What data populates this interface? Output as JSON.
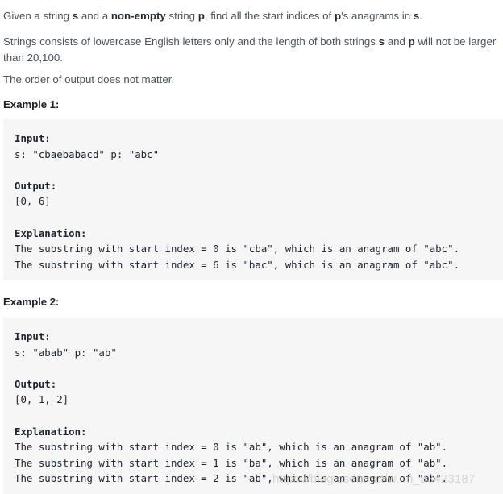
{
  "problem": {
    "paragraph1": {
      "seg1": "Given a string ",
      "bold1": "s",
      "seg2": " and a ",
      "bold2": "non-empty",
      "seg3": " string ",
      "bold3": "p",
      "seg4": ", find all the start indices of ",
      "bold4": "p",
      "seg5": "'s anagrams in ",
      "bold5": "s",
      "seg6": "."
    },
    "paragraph2": {
      "seg1": "Strings consists of lowercase English letters only and the length of both strings ",
      "bold1": "s",
      "seg2": " and ",
      "bold2": "p",
      "seg3": " will not be larger than 20,100."
    },
    "paragraph3": "The order of output does not matter."
  },
  "examples": [
    {
      "heading": "Example 1:",
      "input_label": "Input:",
      "input_value": "s: \"cbaebabacd\" p: \"abc\"",
      "output_label": "Output:",
      "output_value": "[0, 6]",
      "explanation_label": "Explanation:",
      "explanation_lines": [
        "The substring with start index = 0 is \"cba\", which is an anagram of \"abc\".",
        "The substring with start index = 6 is \"bac\", which is an anagram of \"abc\"."
      ]
    },
    {
      "heading": "Example 2:",
      "input_label": "Input:",
      "input_value": "s: \"abab\" p: \"ab\"",
      "output_label": "Output:",
      "output_value": "[0, 1, 2]",
      "explanation_label": "Explanation:",
      "explanation_lines": [
        "The substring with start index = 0 is \"ab\", which is an anagram of \"ab\".",
        "The substring with start index = 1 is \"ba\", which is an anagram of \"ab\".",
        "The substring with start index = 2 is \"ab\", which is an anagram of \"ab\"."
      ]
    }
  ],
  "watermark": {
    "text": "https://blog.csdn.net/w...n_33423187"
  },
  "colors": {
    "code_background": "#f6f6f6",
    "body_text": "#4a5362",
    "heading_text": "#1b1f27",
    "code_text": "#1c2330",
    "watermark_text": "#c9c9c9"
  }
}
